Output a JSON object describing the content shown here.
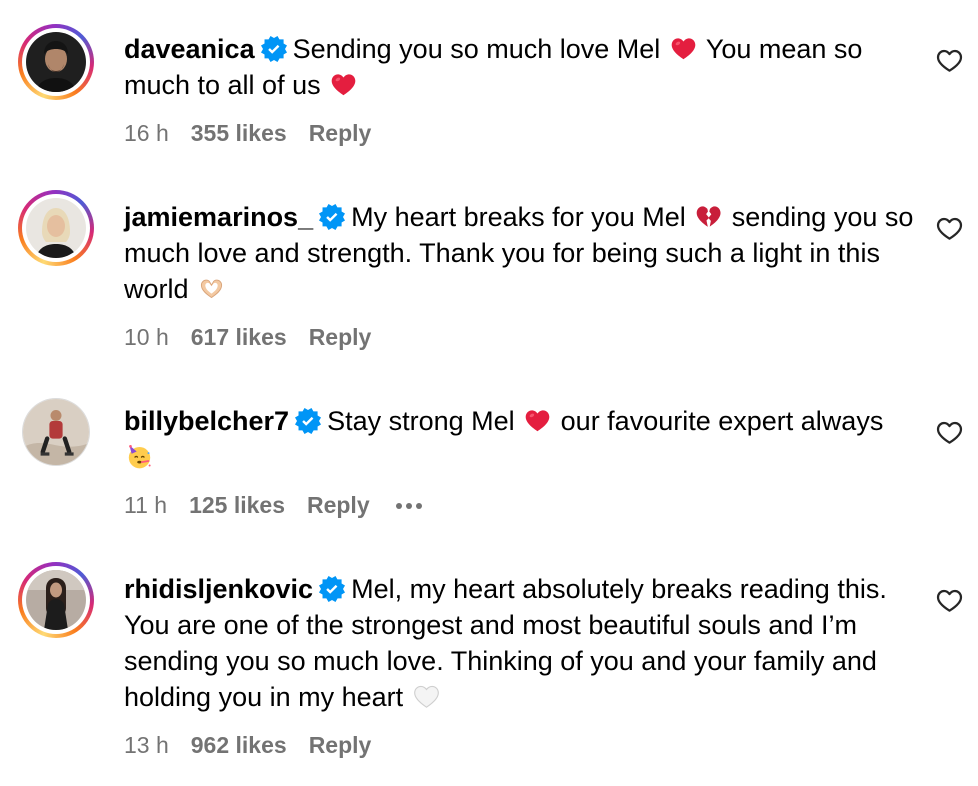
{
  "colors": {
    "text": "#000000",
    "meta_text": "#737373",
    "verified_badge": "#0095f6",
    "red_heart": "#e41e3f"
  },
  "icons": {
    "verified": "verified-badge-icon",
    "like": "heart-outline-icon",
    "more": "more-options-icon"
  },
  "comments": [
    {
      "username": "daveanica",
      "verified": true,
      "text_parts": [
        "Sending you so much love Mel ",
        " You mean so much to all of us "
      ],
      "emojis": [
        "red-heart",
        "red-heart"
      ],
      "time": "16 h",
      "likes": "355 likes",
      "reply": "Reply",
      "avatar_story_ring": true
    },
    {
      "username": "jamiemarinos_",
      "verified": true,
      "text_parts": [
        "My heart breaks for you Mel ",
        " sending you so much love and strength. Thank you for being such a light in this world "
      ],
      "emojis": [
        "broken-heart",
        "heart-hands"
      ],
      "time": "10 h",
      "likes": "617 likes",
      "reply": "Reply",
      "avatar_story_ring": true
    },
    {
      "username": "billybelcher7",
      "verified": true,
      "text_parts": [
        "Stay strong Mel ",
        " our favourite expert always "
      ],
      "emojis": [
        "red-heart",
        "partying-face"
      ],
      "time": "11 h",
      "likes": "125 likes",
      "reply": "Reply",
      "avatar_story_ring": false,
      "show_more": true
    },
    {
      "username": "rhidisljenkovic",
      "verified": true,
      "text_parts": [
        "Mel, my heart absolutely breaks reading this. You are one of the strongest and most beautiful souls and I’m sending you so much love. Thinking of you and your family and holding you in my heart "
      ],
      "emojis": [
        "white-heart"
      ],
      "time": "13 h",
      "likes": "962 likes",
      "reply": "Reply",
      "avatar_story_ring": true
    }
  ]
}
